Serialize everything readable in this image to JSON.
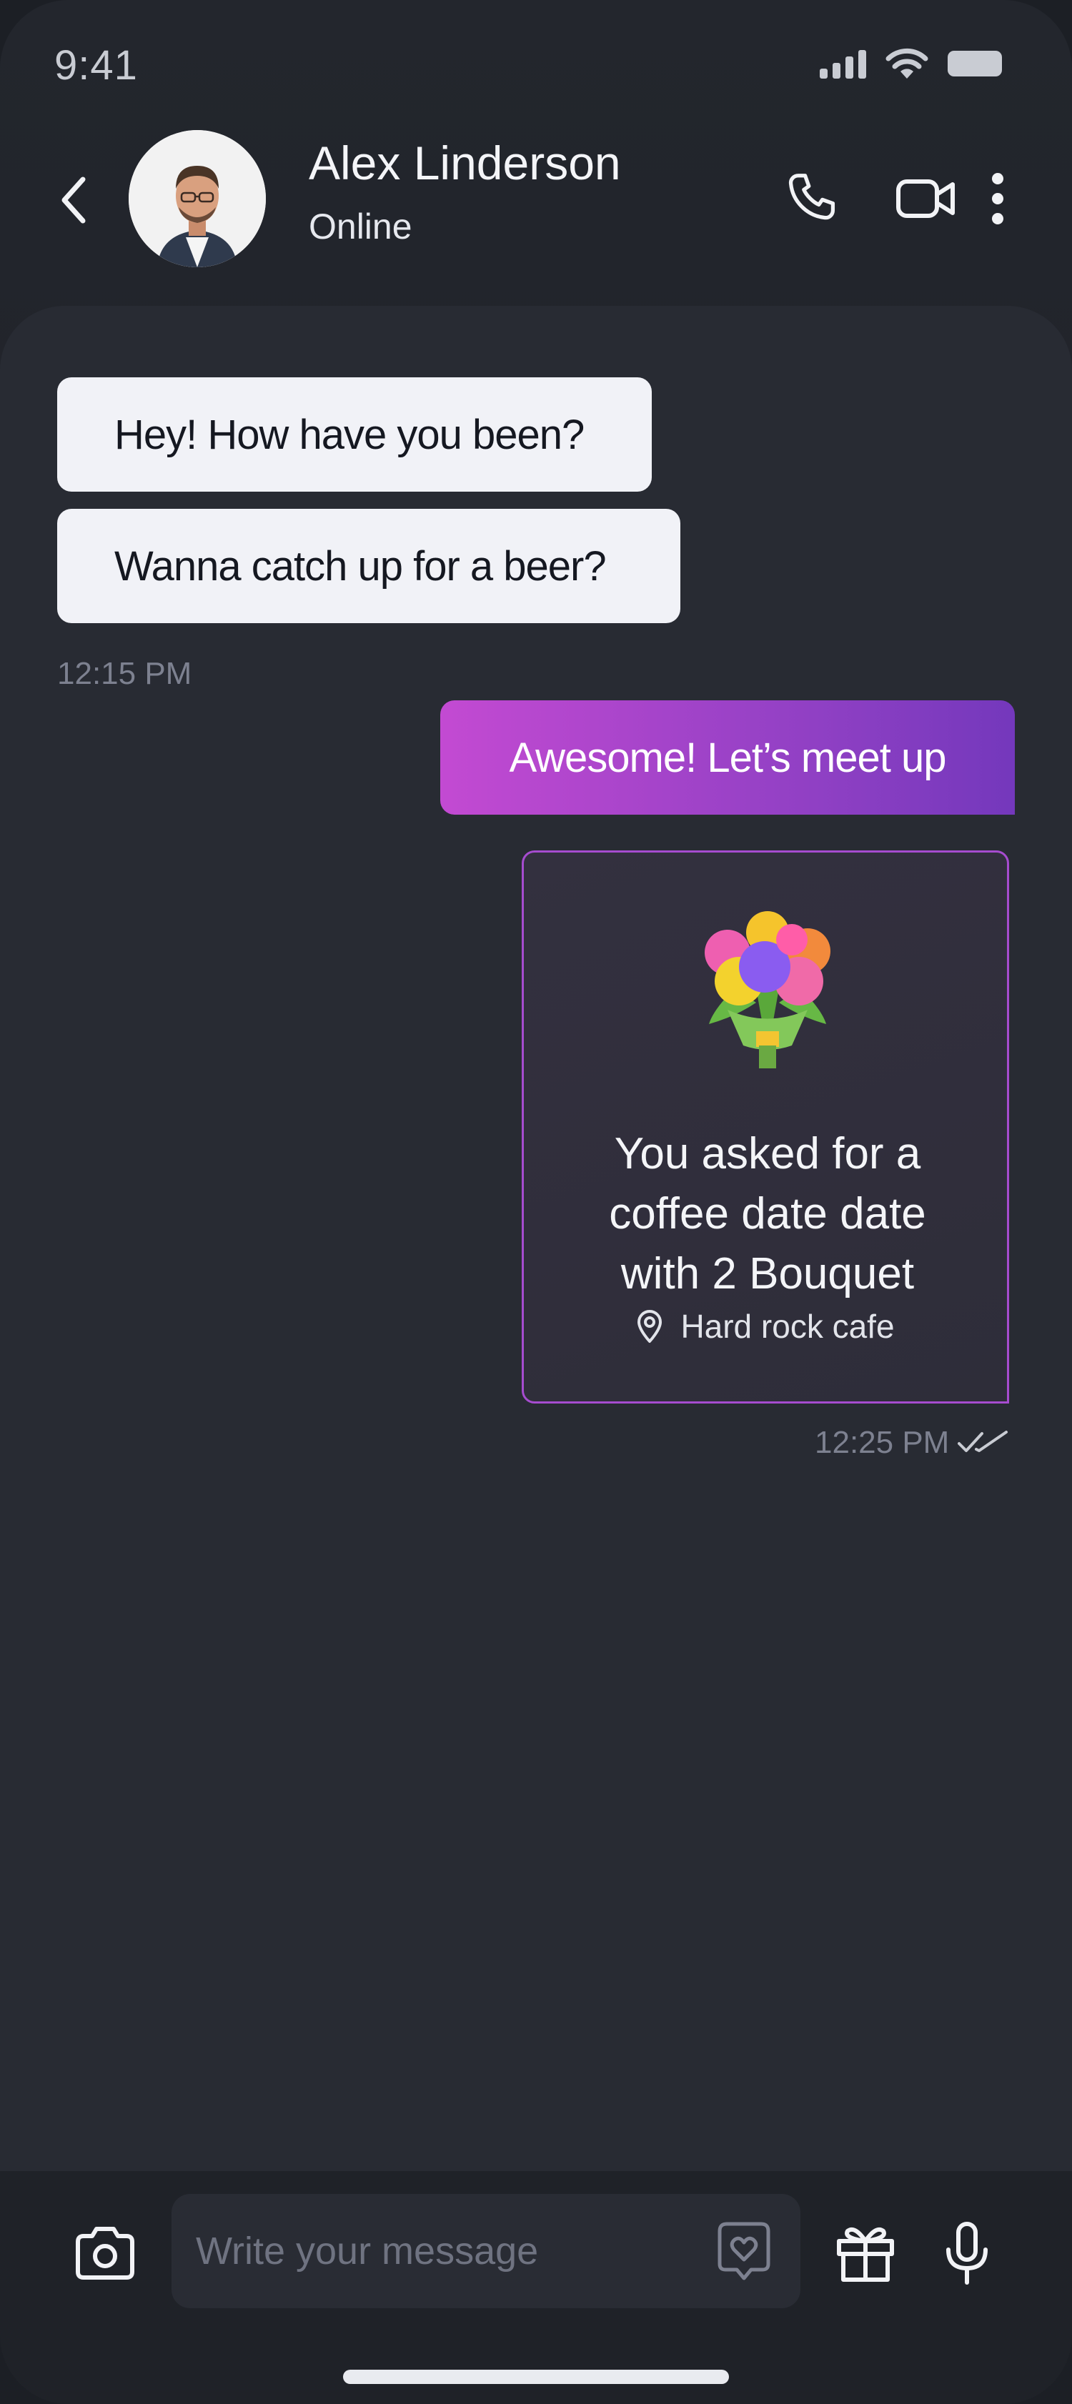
{
  "status_bar": {
    "time": "9:41"
  },
  "header": {
    "contact_name": "Alex Linderson",
    "contact_status": "Online"
  },
  "messages": {
    "incoming": [
      {
        "text": "Hey! How have you been?"
      },
      {
        "text": "Wanna catch up for a beer?"
      }
    ],
    "incoming_time": "12:15 PM",
    "outgoing": {
      "text": "Awesome! Let’s meet up"
    },
    "gift_card": {
      "text": "You asked for a coffee date date with 2 Bouquet",
      "text_lines": [
        "You asked for a",
        "coffee date date",
        "with 2 Bouquet"
      ],
      "location": "Hard rock cafe"
    },
    "outgoing_time": "12:25 PM"
  },
  "composer": {
    "placeholder": "Write your message",
    "value": ""
  },
  "colors": {
    "background": "#282b33",
    "incoming_bubble": "#f1f2f7",
    "outgoing_gradient_start": "#c34ad2",
    "outgoing_gradient_end": "#7438bc",
    "card_border": "#a64ccf"
  },
  "icons": [
    "signal-icon",
    "wifi-icon",
    "battery-icon",
    "back-icon",
    "phone-icon",
    "video-icon",
    "more-icon",
    "bouquet-icon",
    "location-pin-icon",
    "double-check-icon",
    "camera-icon",
    "heart-sticker-icon",
    "gift-icon",
    "microphone-icon"
  ]
}
